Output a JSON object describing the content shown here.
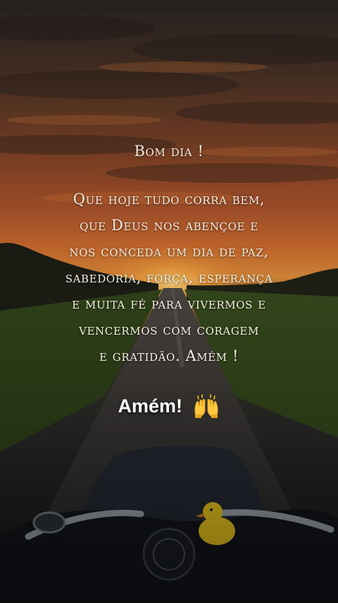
{
  "post": {
    "greeting": "Bom dia !",
    "lines": [
      "Que hoje tudo corra bem,",
      "que Deus nos abençoe e",
      "nos conceda um dia de paz,",
      "sabedoria, força, esperança",
      "e muita fé para vivermos e",
      "vencermos com coragem",
      "e gratidão. Amém !"
    ],
    "caption": "Amém!",
    "caption_emoji": "raising-hands-icon"
  },
  "colors": {
    "sky_top": "#2a2520",
    "sunset_orange": "#c9642a",
    "sun_glow": "#f2a23a",
    "road": "#3a3a3f",
    "grass": "#3f5a22",
    "text": "#f4ece0"
  }
}
